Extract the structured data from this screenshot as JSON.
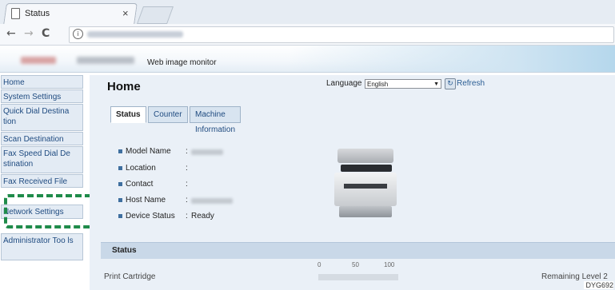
{
  "browser": {
    "tab_title": "Status",
    "tab_close": "×",
    "back": "←",
    "forward": "→",
    "reload": "C",
    "info": "i"
  },
  "header": {
    "product_label": "Web image monitor"
  },
  "sidebar": {
    "items": [
      {
        "label": "Home"
      },
      {
        "label": "System Settings"
      },
      {
        "label": "Quick Dial Destina tion"
      },
      {
        "label": "Scan Destination"
      },
      {
        "label": "Fax Speed Dial De stination"
      },
      {
        "label": "Fax Received File"
      },
      {
        "label": "Network Settings"
      },
      {
        "label": "Administrator Too ls"
      }
    ]
  },
  "main": {
    "title": "Home",
    "language_label": "Language",
    "language_value": "English",
    "refresh_label": "Refresh",
    "tabs": [
      {
        "label": "Status"
      },
      {
        "label": "Counter"
      },
      {
        "label": "Machine Information"
      }
    ],
    "info": [
      {
        "label": "Model Name",
        "value": ""
      },
      {
        "label": "Location",
        "value": ""
      },
      {
        "label": "Contact",
        "value": ""
      },
      {
        "label": "Host Name",
        "value": ""
      },
      {
        "label": "Device Status",
        "value": "Ready"
      }
    ],
    "status_section": {
      "title": "Status",
      "scale": [
        "0",
        "50",
        "100"
      ],
      "row_label": "Print Cartridge",
      "row_right": "Remaining Level 2"
    }
  },
  "figure_code": "DYG692"
}
